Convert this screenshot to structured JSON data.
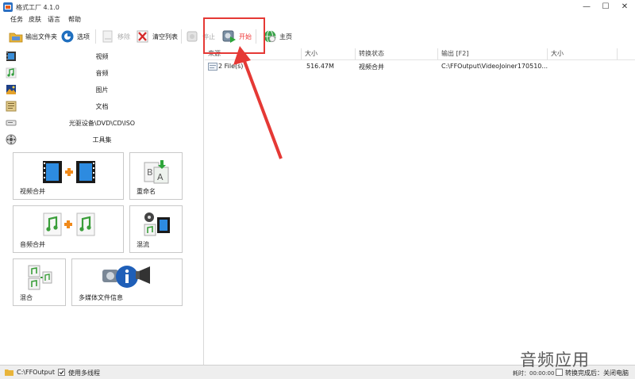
{
  "window": {
    "title": "格式工厂 4.1.0",
    "minimize": "—",
    "maximize": "☐",
    "close": "✕"
  },
  "menu": [
    "任务",
    "皮肤",
    "语言",
    "帮助"
  ],
  "toolbar": {
    "output_folder": "输出文件夹",
    "options": "选项",
    "remove": "移除",
    "clear_list": "清空列表",
    "stop": "停止",
    "start": "开始",
    "home": "主页"
  },
  "sidebar": {
    "categories": [
      {
        "label": "视频",
        "icon": "film-icon"
      },
      {
        "label": "音频",
        "icon": "music-note-icon"
      },
      {
        "label": "图片",
        "icon": "picture-icon"
      },
      {
        "label": "文档",
        "icon": "document-icon"
      },
      {
        "label": "光驱设备\\DVD\\CD\\ISO",
        "icon": "optical-drive-icon"
      },
      {
        "label": "工具集",
        "icon": "toolbox-icon"
      }
    ],
    "tools": [
      {
        "label": "视频合并",
        "icon": "video-join-icon"
      },
      {
        "label": "重命名",
        "icon": "rename-icon"
      },
      {
        "label": "音频合并",
        "icon": "audio-join-icon"
      },
      {
        "label": "混流",
        "icon": "mux-icon"
      },
      {
        "label": "混合",
        "icon": "mix-icon"
      },
      {
        "label": "多媒体文件信息",
        "icon": "media-info-icon"
      }
    ]
  },
  "task_list": {
    "columns": [
      "来源",
      "大小",
      "转换状态",
      "输出 [F2]",
      "大小"
    ],
    "rows": [
      {
        "source": "2 File(s)",
        "size": "516.47M",
        "status": "视频合并",
        "output": "C:\\FFOutput\\VideoJoiner170510...",
        "out_size": ""
      }
    ]
  },
  "statusbar": {
    "output_path": "C:\\FFOutput",
    "multithread_label": "使用多线程",
    "multithread_checked": true,
    "elapsed": "耗时：00:00:00",
    "after_convert_label": "转换完成后：关闭电脑",
    "after_convert_checked": false
  },
  "watermark": "音频应用",
  "colors": {
    "highlight": "#e53935",
    "start_label": "#e33333"
  }
}
